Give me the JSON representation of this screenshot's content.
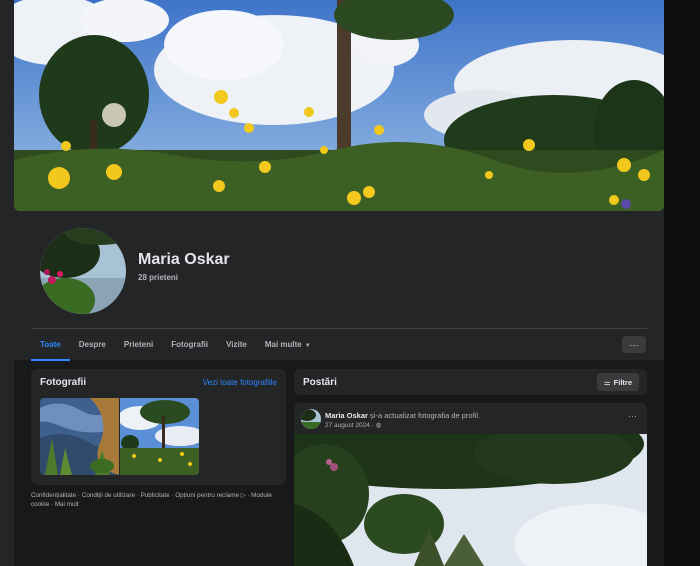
{
  "profile": {
    "name": "Maria Oskar",
    "friends": "28 prieteni"
  },
  "tabs": [
    {
      "label": "Toate",
      "active": true
    },
    {
      "label": "Despre"
    },
    {
      "label": "Prieteni"
    },
    {
      "label": "Fotografii"
    },
    {
      "label": "Vizite"
    },
    {
      "label": "Mai multe",
      "icon": "caret-down-icon"
    }
  ],
  "more_button": {
    "icon": "ellipsis-icon",
    "label": "···"
  },
  "photos": {
    "title": "Fotografii",
    "see_all": "Vezi toate fotografiile"
  },
  "footer": {
    "links": [
      "Confidențialitate",
      "Condiții de utilizare",
      "Publicitate",
      "Opțiuni pentru reclame",
      "Module cookie",
      "Mai mult"
    ],
    "separator": " · "
  },
  "posts": {
    "title": "Postări",
    "filter_label": "Filtre",
    "filter_icon": "sliders-icon"
  },
  "post": {
    "author": "Maria Oskar",
    "action": "și-a actualizat fotografia de profil.",
    "date": "27 august 2024",
    "audience_icon": "globe-icon",
    "menu": "···"
  },
  "colors": {
    "accent": "#2d88ff",
    "card": "#242526",
    "background": "#18191a"
  }
}
